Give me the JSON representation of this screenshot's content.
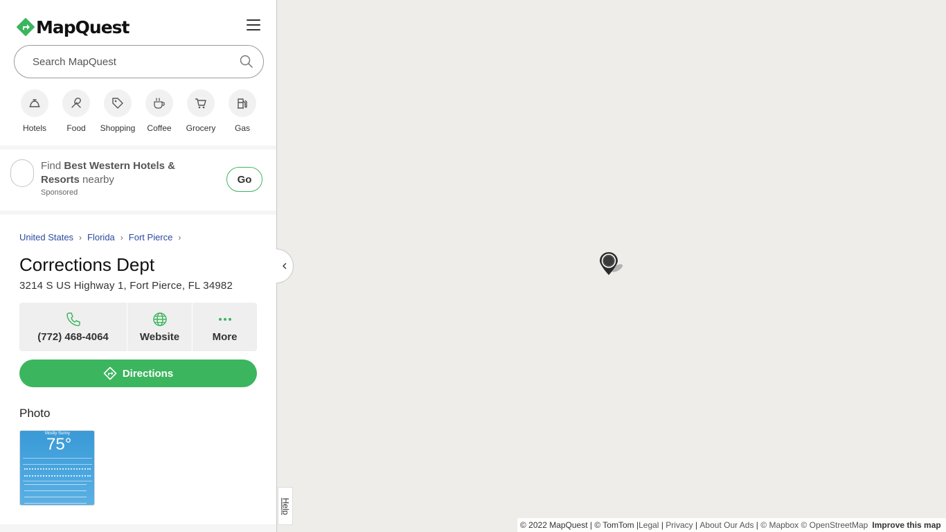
{
  "brand": {
    "name": "MapQuest",
    "accent": "#3cb55f"
  },
  "search": {
    "placeholder": "Search MapQuest"
  },
  "categories": [
    {
      "label": "Hotels",
      "icon": "hotel-bell-icon"
    },
    {
      "label": "Food",
      "icon": "utensils-icon"
    },
    {
      "label": "Shopping",
      "icon": "tag-icon"
    },
    {
      "label": "Coffee",
      "icon": "coffee-cup-icon"
    },
    {
      "label": "Grocery",
      "icon": "cart-icon"
    },
    {
      "label": "Gas",
      "icon": "gas-pump-icon"
    }
  ],
  "sponsored": {
    "prefix": "Find ",
    "brand": "Best Western Hotels & Resorts",
    "suffix": " nearby",
    "tag": "Sponsored",
    "go_label": "Go"
  },
  "breadcrumbs": [
    "United States",
    "Florida",
    "Fort Pierce"
  ],
  "place": {
    "name": "Corrections Dept",
    "address": "3214 S US Highway 1, Fort Pierce, FL 34982"
  },
  "actions": {
    "phone": "(772) 468-4064",
    "website": "Website",
    "more": "More",
    "directions": "Directions"
  },
  "photo": {
    "heading": "Photo",
    "weather_condition": "Mostly Sunny",
    "weather_temp": "75°"
  },
  "help_label": "Help",
  "footer": {
    "copyright": "© 2022 MapQuest | © TomTom | ",
    "legal": "Legal",
    "privacy": "Privacy",
    "ads": "About Our Ads",
    "credits": "© Mapbox © OpenStreetMap",
    "improve": "Improve this map"
  }
}
